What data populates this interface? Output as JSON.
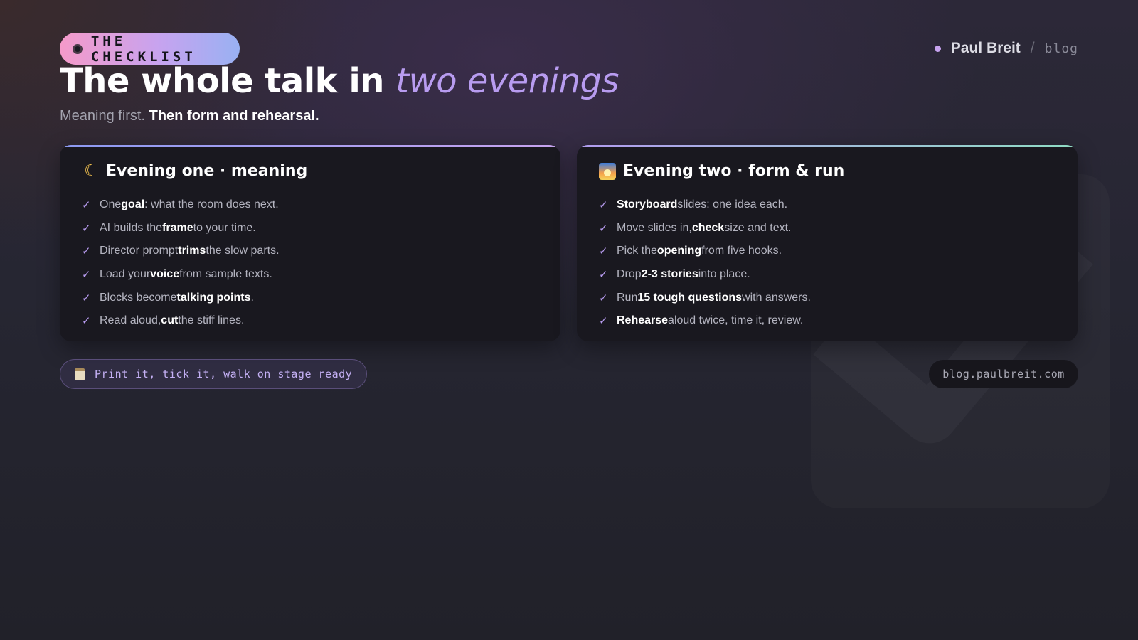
{
  "tag": {
    "label": "THE CHECKLIST"
  },
  "brand": {
    "name": "Paul Breit",
    "separator": "/",
    "section": "blog",
    "accent": "#c7a3ef"
  },
  "title": {
    "main": "The whole talk in ",
    "accent": "two evenings"
  },
  "subtitle": {
    "lead": "Meaning first. ",
    "emphasis": "Then form and rehearsal."
  },
  "cards": [
    {
      "heading": "Evening one · meaning",
      "icon": "crescent-moon-icon",
      "items": [
        {
          "pre": "One ",
          "bold": "goal",
          "post": ": what the room does next."
        },
        {
          "pre": "AI builds the ",
          "bold": "frame",
          "post": " to your time."
        },
        {
          "pre": "Director prompt ",
          "bold": "trims",
          "post": " the slow parts."
        },
        {
          "pre": "Load your ",
          "bold": "voice",
          "post": " from sample texts."
        },
        {
          "pre": "Blocks become ",
          "bold": "talking points",
          "post": "."
        },
        {
          "pre": "Read aloud, ",
          "bold": "cut",
          "post": " the stiff lines."
        }
      ]
    },
    {
      "heading": "Evening two · form & run",
      "icon": "sunrise-icon",
      "items": [
        {
          "pre": "",
          "bold": "Storyboard",
          "post": " slides: one idea each."
        },
        {
          "pre": "Move slides in, ",
          "bold": "check",
          "post": " size and text."
        },
        {
          "pre": "Pick the ",
          "bold": "opening",
          "post": " from five hooks."
        },
        {
          "pre": "Drop ",
          "bold": "2-3 stories",
          "post": " into place."
        },
        {
          "pre": "Run ",
          "bold": "15 tough questions",
          "post": " with answers."
        },
        {
          "pre": "",
          "bold": "Rehearse",
          "post": " aloud twice, time it, review."
        }
      ]
    }
  ],
  "check_glyph": "✓",
  "footer": {
    "note": "Print it, tick it, walk on stage ready",
    "icon": "clipboard-icon",
    "url": "blog.paulbreit.com"
  }
}
